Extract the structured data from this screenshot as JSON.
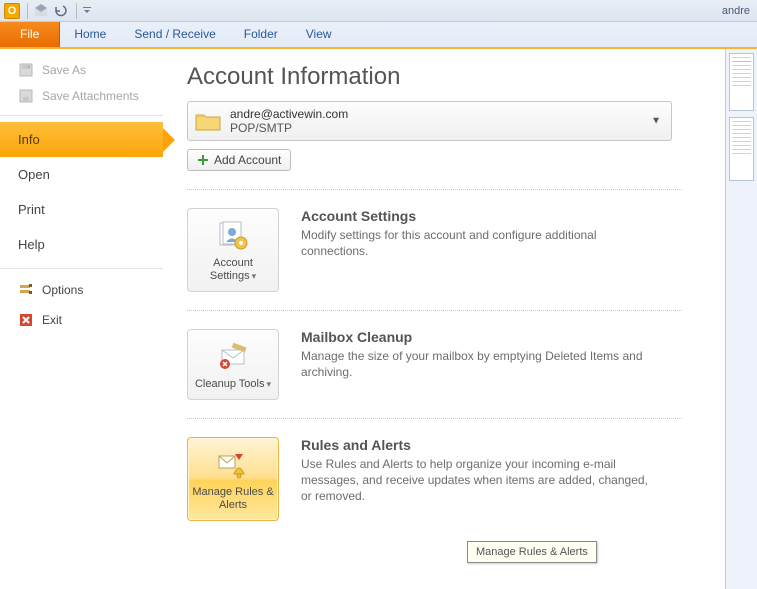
{
  "titlebar": {
    "user": "andre"
  },
  "ribbon": {
    "tabs": {
      "file": "File",
      "home": "Home",
      "sendreceive": "Send / Receive",
      "folder": "Folder",
      "view": "View"
    }
  },
  "backstage_left": {
    "save_as": "Save As",
    "save_attachments": "Save Attachments",
    "info": "Info",
    "open": "Open",
    "print": "Print",
    "help": "Help",
    "options": "Options",
    "exit": "Exit"
  },
  "account_info": {
    "title": "Account Information",
    "email": "andre@activewin.com",
    "protocol": "POP/SMTP",
    "add_account": "Add Account"
  },
  "sections": {
    "settings": {
      "button": "Account Settings",
      "title": "Account Settings",
      "desc": "Modify settings for this account and configure additional connections."
    },
    "cleanup": {
      "button": "Cleanup Tools",
      "title": "Mailbox Cleanup",
      "desc": "Manage the size of your mailbox by emptying Deleted Items and archiving."
    },
    "rules": {
      "button": "Manage Rules & Alerts",
      "title": "Rules and Alerts",
      "desc": "Use Rules and Alerts to help organize your incoming e-mail messages, and receive updates when items are added, changed, or removed."
    }
  },
  "tooltip": "Manage Rules & Alerts"
}
